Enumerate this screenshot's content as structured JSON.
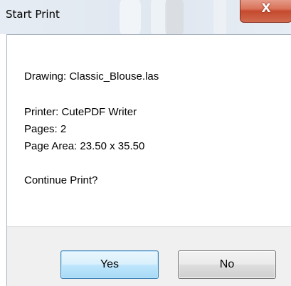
{
  "window": {
    "title": "Start Print",
    "close_symbol": "X"
  },
  "message": {
    "drawing": "Drawing: Classic_Blouse.las",
    "printer": "Printer: CutePDF Writer",
    "pages": "Pages: 2",
    "page_area": "Page Area: 23.50 x 35.50",
    "question": "Continue Print?"
  },
  "buttons": {
    "yes_label": "Yes",
    "no_label": "No"
  },
  "icons": {
    "close": "close-icon"
  },
  "colors": {
    "close_button": "#c54a2e",
    "default_button_border": "#3c7fb1",
    "button_bar": "#f0f0f0"
  }
}
